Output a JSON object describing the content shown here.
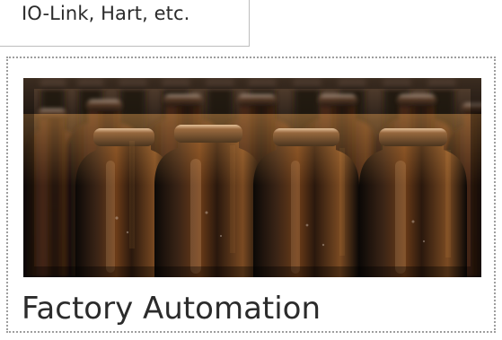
{
  "previous_card": {
    "text": "IO-Link, Hart, etc."
  },
  "tile": {
    "title": "Factory Automation",
    "image_icon": "bottles-photo"
  },
  "colors": {
    "text": "#2b2b2b",
    "outline": "#9e9e9e",
    "divider": "#bdbdbd"
  }
}
